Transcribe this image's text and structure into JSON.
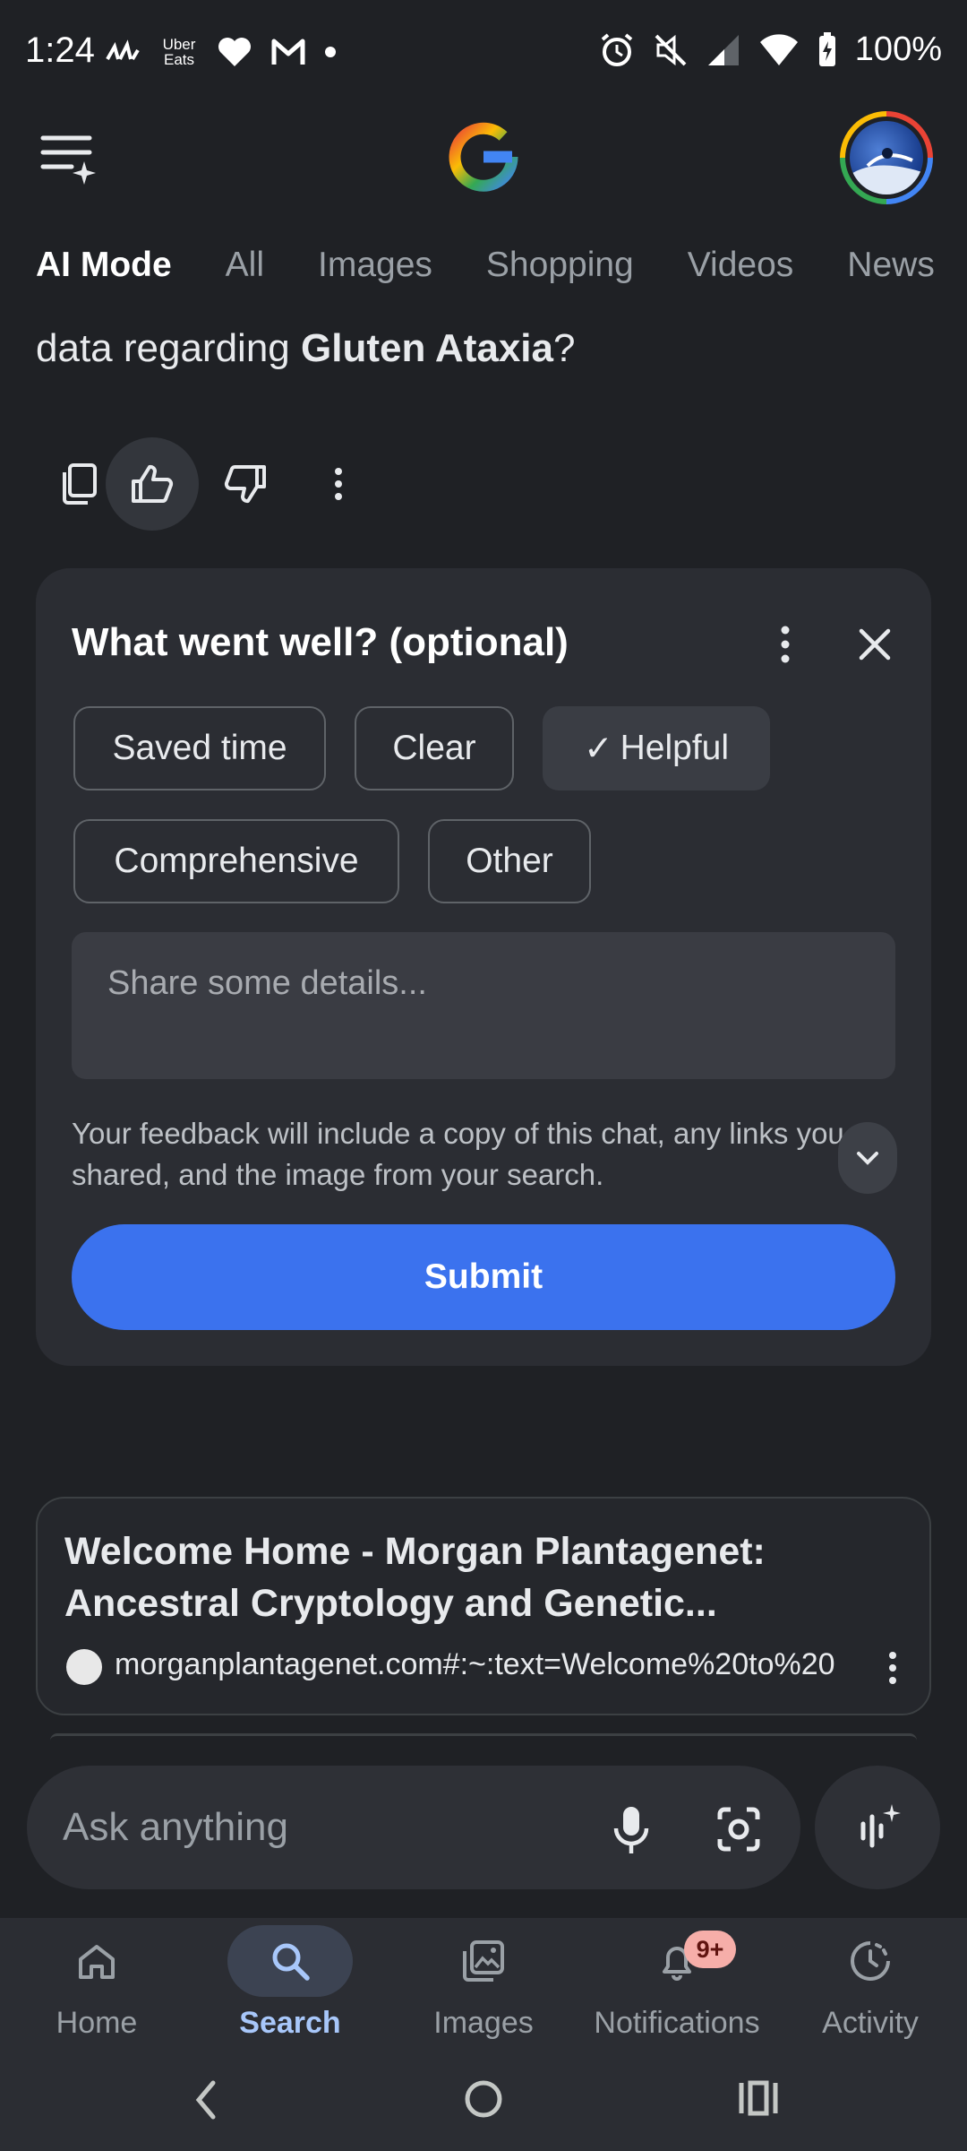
{
  "status_bar": {
    "time": "1:24",
    "battery": "100%",
    "left_icons": [
      "signal-strength-icon",
      "uber-eats-icon",
      "heart-icon",
      "gmail-icon",
      "dot-icon"
    ],
    "right_icons": [
      "alarm-icon",
      "mute-icon",
      "cell-signal-icon",
      "wifi-icon",
      "battery-charging-icon"
    ],
    "uber_eats_text": "Uber Eats"
  },
  "header": {
    "menu_icon": "menu-sparkle-icon",
    "logo": "google-g-logo",
    "avatar": "profile-avatar"
  },
  "tabs": [
    {
      "label": "AI Mode",
      "active": true
    },
    {
      "label": "All",
      "active": false
    },
    {
      "label": "Images",
      "active": false
    },
    {
      "label": "Shopping",
      "active": false
    },
    {
      "label": "Videos",
      "active": false
    },
    {
      "label": "News",
      "active": false
    }
  ],
  "answer": {
    "prefix": "data regarding ",
    "bold": "Gluten Ataxia",
    "suffix": "?"
  },
  "actions": [
    "copy-icon",
    "thumbs-up-icon",
    "thumbs-down-icon",
    "more-vert-icon"
  ],
  "feedback": {
    "title": "What went well? (optional)",
    "chips": [
      {
        "label": "Saved time",
        "selected": false
      },
      {
        "label": "Clear",
        "selected": false
      },
      {
        "label": "Helpful",
        "selected": true
      },
      {
        "label": "Comprehensive",
        "selected": false
      },
      {
        "label": "Other",
        "selected": false
      }
    ],
    "checkmark": "✓",
    "details_placeholder": "Share some details...",
    "disclaimer": "Your feedback will include a copy of this chat, any links you shared, and the image from your search.",
    "submit_label": "Submit"
  },
  "result": {
    "title": "Welcome Home - Morgan Plantagenet: Ancestral Cryptology and Genetic...",
    "url": "morganplantagenet.com#:~:text=Welcome%20to%20"
  },
  "ask": {
    "placeholder": "Ask anything"
  },
  "bottom_nav": [
    {
      "label": "Home",
      "icon": "home-icon",
      "active": false
    },
    {
      "label": "Search",
      "icon": "search-icon",
      "active": true
    },
    {
      "label": "Images",
      "icon": "images-icon",
      "active": false
    },
    {
      "label": "Notifications",
      "icon": "bell-icon",
      "active": false,
      "badge": "9+"
    },
    {
      "label": "Activity",
      "icon": "activity-icon",
      "active": false
    }
  ],
  "colors": {
    "background": "#1f2125",
    "card": "#2b2d33",
    "accent": "#3b72ee",
    "active_nav": "#a8c7fa",
    "badge": "#f6aea9"
  }
}
